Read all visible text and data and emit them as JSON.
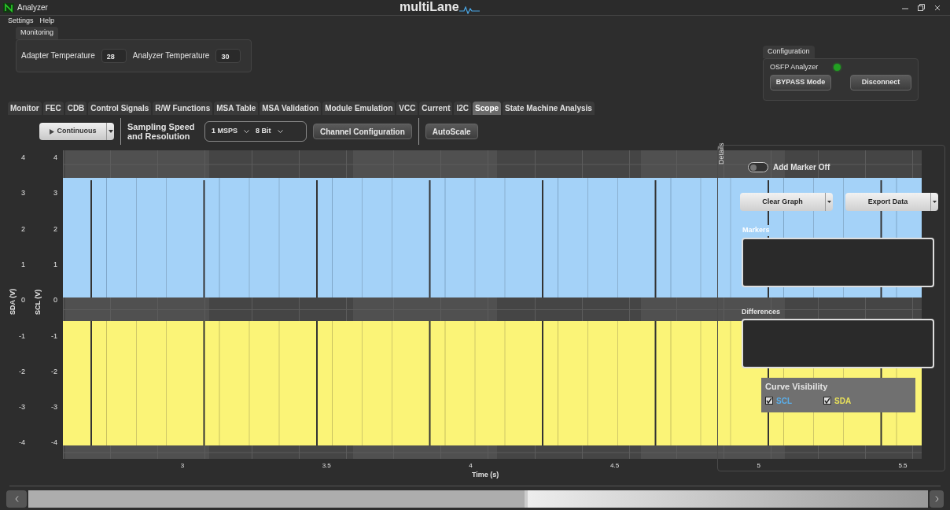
{
  "window": {
    "title": "Analyzer",
    "brand": "multiLane"
  },
  "menu": [
    "Settings",
    "Help"
  ],
  "monitoring": {
    "title": "Monitoring",
    "fields": [
      {
        "label": "Adapter Temperature",
        "value": "28"
      },
      {
        "label": "Analyzer Temperature",
        "value": "30"
      }
    ]
  },
  "configuration": {
    "title": "Configuration",
    "device": "OSFP Analyzer",
    "status_led": {
      "on": true,
      "color": "#22a022"
    },
    "buttons": [
      "BYPASS Mode",
      "Disconnect"
    ]
  },
  "tabs": [
    {
      "label": "Monitor",
      "selected": false
    },
    {
      "label": "FEC",
      "selected": false
    },
    {
      "label": "CDB",
      "selected": false
    },
    {
      "label": "Control Signals",
      "selected": false
    },
    {
      "label": "R/W Functions",
      "selected": false
    },
    {
      "label": "MSA Table",
      "selected": false
    },
    {
      "label": "MSA Validation",
      "selected": false
    },
    {
      "label": "Module Emulation",
      "selected": false
    },
    {
      "label": "VCC",
      "selected": false
    },
    {
      "label": "Current",
      "selected": false
    },
    {
      "label": "I2C",
      "selected": false
    },
    {
      "label": "Scope",
      "selected": true
    },
    {
      "label": "State Machine Analysis",
      "selected": false
    }
  ],
  "toolbar": {
    "run_mode": "Continuous",
    "sampling_label": "Sampling Speed and Resolution",
    "speed": "1 MSPS",
    "resolution": "8 Bit",
    "buttons": [
      "Channel Configuration",
      "AutoScale"
    ]
  },
  "scope": {
    "sda_axis_label": "SDA (V)",
    "scl_axis_label": "SCL (V)",
    "sda_ticks": [
      "4",
      "3",
      "2",
      "1",
      "0",
      "-1",
      "-2",
      "-3",
      "-4"
    ],
    "scl_ticks": [
      "4",
      "3",
      "2",
      "1",
      "0",
      "-1",
      "-2",
      "-3",
      "-4"
    ],
    "x_ticks": [
      "3",
      "3.5",
      "4",
      "4.5",
      "5",
      "5.5"
    ],
    "xlabel": "Time (s)"
  },
  "details": {
    "tab_label": "Details",
    "marker_toggle": {
      "label": "Add Marker Off",
      "on": false
    },
    "buttons": [
      "Clear Graph",
      "Export Data"
    ],
    "markers_label": "Markers",
    "differences_label": "Differences",
    "curve_visibility": {
      "title": "Curve Visibility",
      "curves": [
        {
          "label": "SCL",
          "checked": true,
          "color": "#5aaeea"
        },
        {
          "label": "SDA",
          "checked": true,
          "color": "#e8e05a"
        }
      ]
    }
  }
}
